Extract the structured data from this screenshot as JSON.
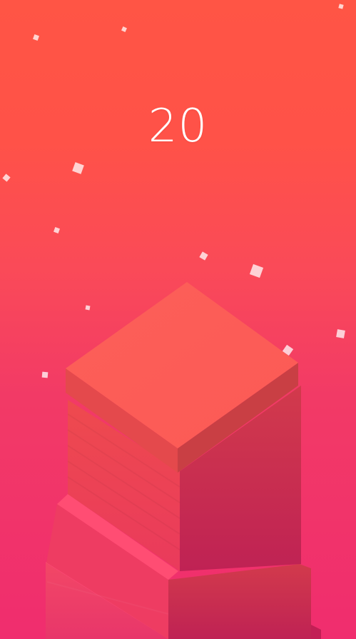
{
  "game": {
    "score": "20"
  },
  "colors": {
    "bg_top": "#ff5545",
    "bg_bottom": "#f02d6e",
    "top_block": "#fd5c57",
    "top_block_left": "#e4494c",
    "top_block_right": "#c93f44"
  },
  "icons": {
    "particle": "square"
  }
}
